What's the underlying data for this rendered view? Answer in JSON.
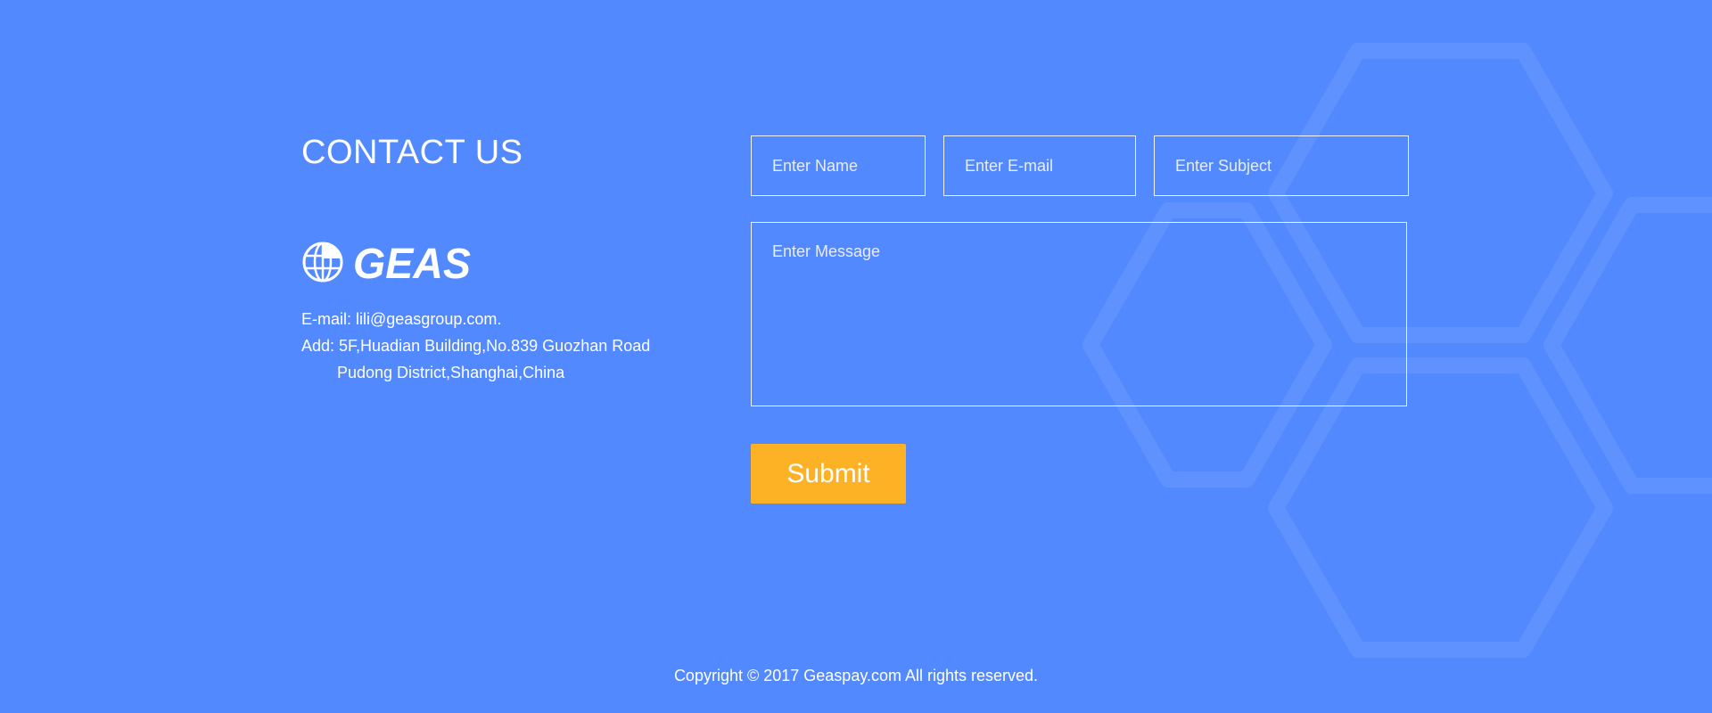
{
  "colors": {
    "background": "#5389ff",
    "text": "#ffffff",
    "submit_button": "#fdb125"
  },
  "contact": {
    "title": "CONTACT US",
    "logo_text": "GEAS",
    "email_line": "E-mail: lili@geasgroup.com.",
    "address_line1": "Add: 5F,Huadian Building,No.839 Guozhan Road",
    "address_line2": "Pudong District,Shanghai,China"
  },
  "form": {
    "name_placeholder": "Enter Name",
    "name_value": "",
    "email_placeholder": "Enter E-mail",
    "email_value": "",
    "subject_placeholder": "Enter Subject",
    "subject_value": "",
    "message_placeholder": "Enter Message",
    "message_value": "",
    "submit_label": "Submit"
  },
  "footer": {
    "copyright": "Copyright © 2017 Geaspay.com All rights reserved."
  },
  "icons": {
    "logo": "globe-icon"
  }
}
